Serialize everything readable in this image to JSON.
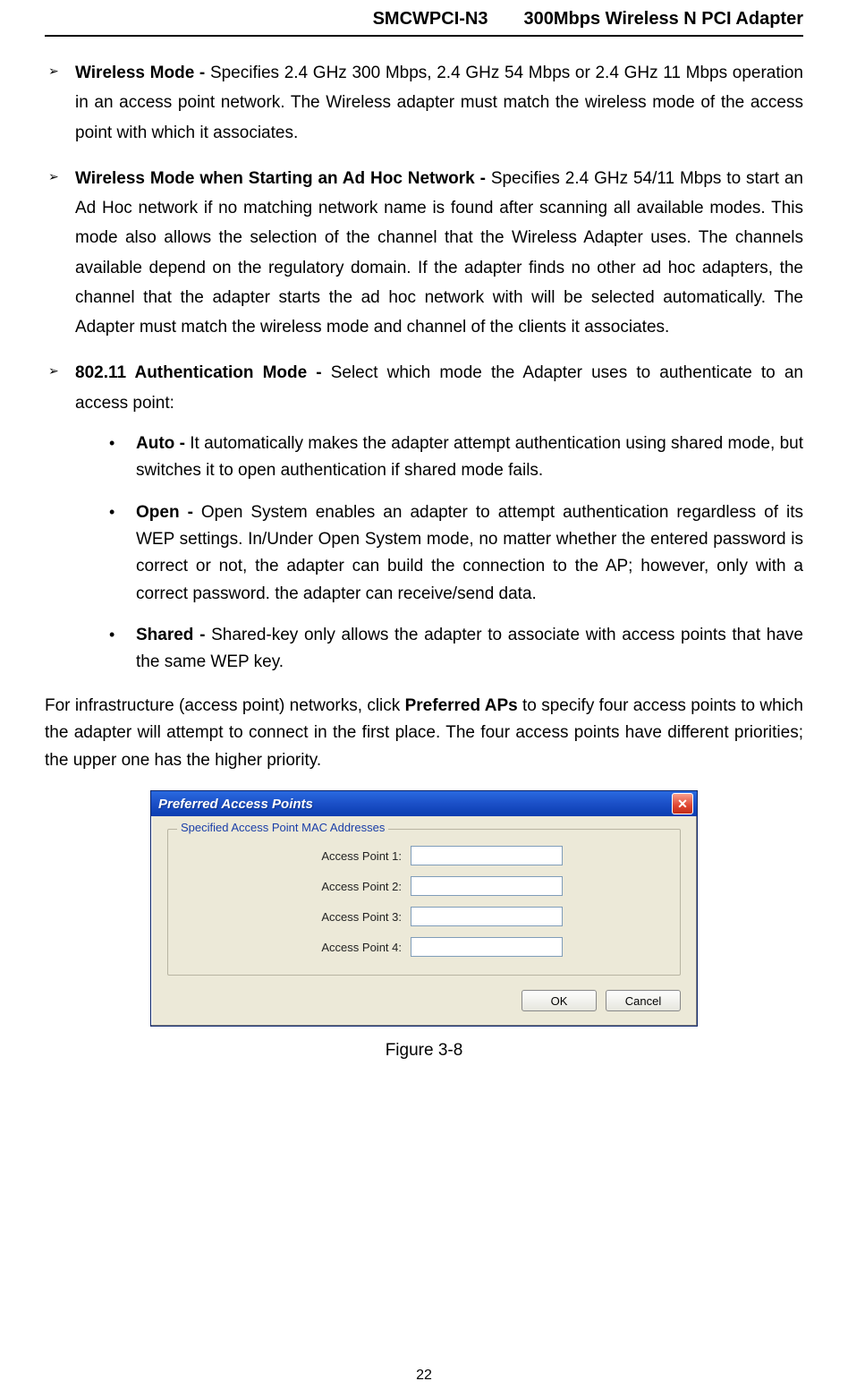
{
  "header": {
    "model": "SMCWPCI-N3",
    "product": "300Mbps Wireless N PCI Adapter"
  },
  "list1": {
    "item1": {
      "label": "Wireless Mode - ",
      "text": "Specifies 2.4 GHz 300 Mbps, 2.4 GHz 54 Mbps or 2.4 GHz 11 Mbps operation in an access point network. The Wireless adapter must match the wireless mode of the access point with which it associates."
    },
    "item2": {
      "label": "Wireless Mode when Starting an Ad Hoc Network - ",
      "text": "Specifies 2.4 GHz 54/11 Mbps to start an Ad Hoc network if no matching network name is found after scanning all available modes. This mode also allows the selection of the channel that the Wireless Adapter uses. The channels available depend on the regulatory domain. If the adapter finds no other ad hoc adapters, the channel that the adapter starts the ad hoc network with will be selected automatically. The Adapter must match the wireless mode and channel of the clients it associates."
    },
    "item3": {
      "label": "802.11 Authentication Mode - ",
      "text": "Select which mode the Adapter uses to authenticate to an access point:"
    }
  },
  "sublist": {
    "auto": {
      "label": "Auto - ",
      "text": "It automatically makes the adapter attempt authentication using shared mode, but switches it to open authentication if shared mode fails."
    },
    "open": {
      "label": "Open - ",
      "text": "Open System enables an adapter to attempt authentication regardless of its WEP settings. In/Under Open System mode, no matter whether the entered password is correct or not, the adapter can build the connection to the AP; however, only with a correct password. the adapter can receive/send data."
    },
    "shared": {
      "label": "Shared - ",
      "text": "Shared-key only allows the adapter to associate with access points that have the same WEP key."
    }
  },
  "paragraph": {
    "pre": "For infrastructure (access point) networks, click ",
    "bold": "Preferred APs",
    "post": " to specify four access points to which the adapter will attempt to connect in the first place. The four access points have different priorities; the upper one has the higher priority."
  },
  "dialog": {
    "title": "Preferred Access Points",
    "close_symbol": "✕",
    "group_legend": "Specified Access Point MAC Addresses",
    "fields": {
      "ap1": {
        "label": "Access Point 1:",
        "value": ""
      },
      "ap2": {
        "label": "Access Point 2:",
        "value": ""
      },
      "ap3": {
        "label": "Access Point 3:",
        "value": ""
      },
      "ap4": {
        "label": "Access Point 4:",
        "value": ""
      }
    },
    "buttons": {
      "ok": "OK",
      "cancel": "Cancel"
    }
  },
  "figure_caption": "Figure 3-8",
  "page_number": "22"
}
